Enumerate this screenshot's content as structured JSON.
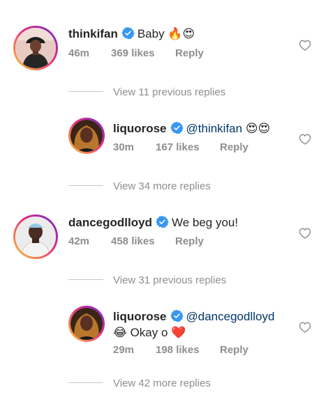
{
  "comments": [
    {
      "username": "thinkifan",
      "text": "Baby 🔥😍",
      "time": "46m",
      "likes": "369 likes",
      "reply": "Reply",
      "verified": true
    },
    {
      "username": "liquorose",
      "mention": "@thinkifan",
      "text": "😍😍",
      "time": "30m",
      "likes": "167 likes",
      "reply": "Reply",
      "verified": true
    },
    {
      "username": "dancegodlloyd",
      "text": "We beg you!",
      "time": "42m",
      "likes": "458 likes",
      "reply": "Reply",
      "verified": true
    },
    {
      "username": "liquorose",
      "mention": "@dancegodlloyd",
      "text": "😂 Okay o ❤️",
      "time": "29m",
      "likes": "198 likes",
      "reply": "Reply",
      "verified": true
    }
  ],
  "reply_links": [
    "View 11 previous replies",
    "View 34 more replies",
    "View 31 previous replies",
    "View 42 more replies"
  ],
  "colors": {
    "verified": "#3897f0",
    "meta": "#8e8e8e",
    "mention": "#00376b",
    "heart_outline": "#8e8e8e"
  },
  "icons": {
    "verified": "verified-badge-icon",
    "like": "heart-outline-icon"
  }
}
